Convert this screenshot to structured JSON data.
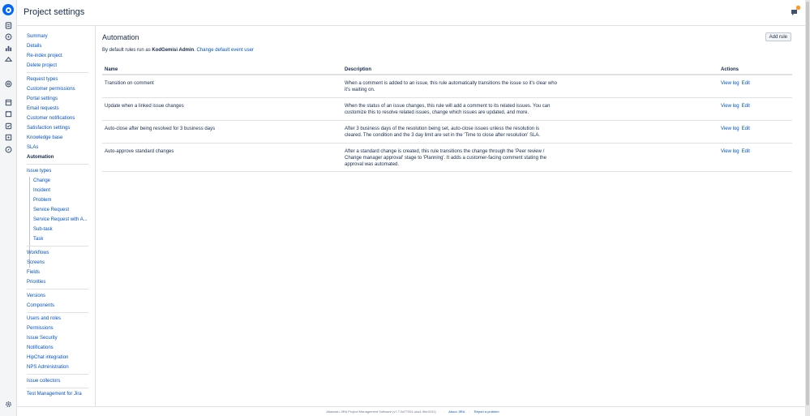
{
  "header": {
    "title": "Project settings"
  },
  "sidebar": {
    "group1": [
      {
        "label": "Summary"
      },
      {
        "label": "Details"
      },
      {
        "label": "Re-index project"
      },
      {
        "label": "Delete project"
      }
    ],
    "group2": [
      {
        "label": "Request types"
      },
      {
        "label": "Customer permissions"
      },
      {
        "label": "Portal settings"
      },
      {
        "label": "Email requests"
      },
      {
        "label": "Customer notifications"
      },
      {
        "label": "Satisfaction settings"
      },
      {
        "label": "Knowledge base"
      },
      {
        "label": "SLAs"
      },
      {
        "label": "Automation"
      }
    ],
    "issue_types_label": "Issue types",
    "issue_types": [
      {
        "label": "Change"
      },
      {
        "label": "Incident"
      },
      {
        "label": "Problem"
      },
      {
        "label": "Service Request"
      },
      {
        "label": "Service Request with A..."
      },
      {
        "label": "Sub-task"
      },
      {
        "label": "Task"
      }
    ],
    "group3": [
      {
        "label": "Workflows"
      },
      {
        "label": "Screens"
      },
      {
        "label": "Fields"
      },
      {
        "label": "Priorities"
      }
    ],
    "group4": [
      {
        "label": "Versions"
      },
      {
        "label": "Components"
      }
    ],
    "group5": [
      {
        "label": "Users and roles"
      },
      {
        "label": "Permissions"
      },
      {
        "label": "Issue Security"
      },
      {
        "label": "Notifications"
      },
      {
        "label": "HipChat integration"
      },
      {
        "label": "NPS Administration"
      }
    ],
    "group6": [
      {
        "label": "Issue collectors"
      }
    ],
    "group7": [
      {
        "label": "Test Management for Jira"
      }
    ]
  },
  "main": {
    "section_title": "Automation",
    "add_rule_label": "Add rule",
    "default_prefix": "By default rules run as",
    "default_user": "KodGemisi Admin",
    "default_sep": ".",
    "change_user_link": "Change default event user",
    "table": {
      "headers": {
        "name": "Name",
        "description": "Description",
        "actions": "Actions"
      },
      "rows": [
        {
          "name": "Transition on comment",
          "description": "When a comment is added to an issue, this rule automatically transitions the issue so it's clear who it's waiting on.",
          "view_log": "View log",
          "edit": "Edit"
        },
        {
          "name": "Update when a linked issue changes",
          "description": "When the status of an issue changes, this rule will add a comment to its related issues. You can customize this to resolve related issues, change which issues are updated, and more.",
          "view_log": "View log",
          "edit": "Edit"
        },
        {
          "name": "Auto-close after being resolved for 3 business days",
          "description": "After 3 business days of the resolution being set, auto-close issues unless the resolution is cleared. The condition and the 3 day limit are set in the 'Time to close after resolution' SLA.",
          "view_log": "View log",
          "edit": "Edit"
        },
        {
          "name": "Auto-approve standard changes",
          "description": "After a standard change is created, this rule transitions the change through the 'Peer review / Change manager approval' stage to 'Planning'. It adds a customer-facing comment stating the approval was automated.",
          "view_log": "View log",
          "edit": "Edit"
        }
      ]
    }
  },
  "footer": {
    "version": "Atlassian JIRA Project Management Software (v7.7.0#77001-sha1:3be3151)",
    "sep": "·",
    "about": "About JIRA",
    "report": "Report a problem"
  },
  "colors": {
    "link": "#0052cc",
    "text": "#172b4d",
    "brand": "#0065ff",
    "badge": "#ff991f"
  },
  "icons": [
    "jira-logo",
    "board-icon",
    "roadmap-icon",
    "reports-icon",
    "releases-icon",
    "target-icon",
    "queue-icon",
    "calendar-icon",
    "issues-icon",
    "components-icon",
    "add-item-icon",
    "compass-icon",
    "settings-icon",
    "feedback-icon"
  ]
}
